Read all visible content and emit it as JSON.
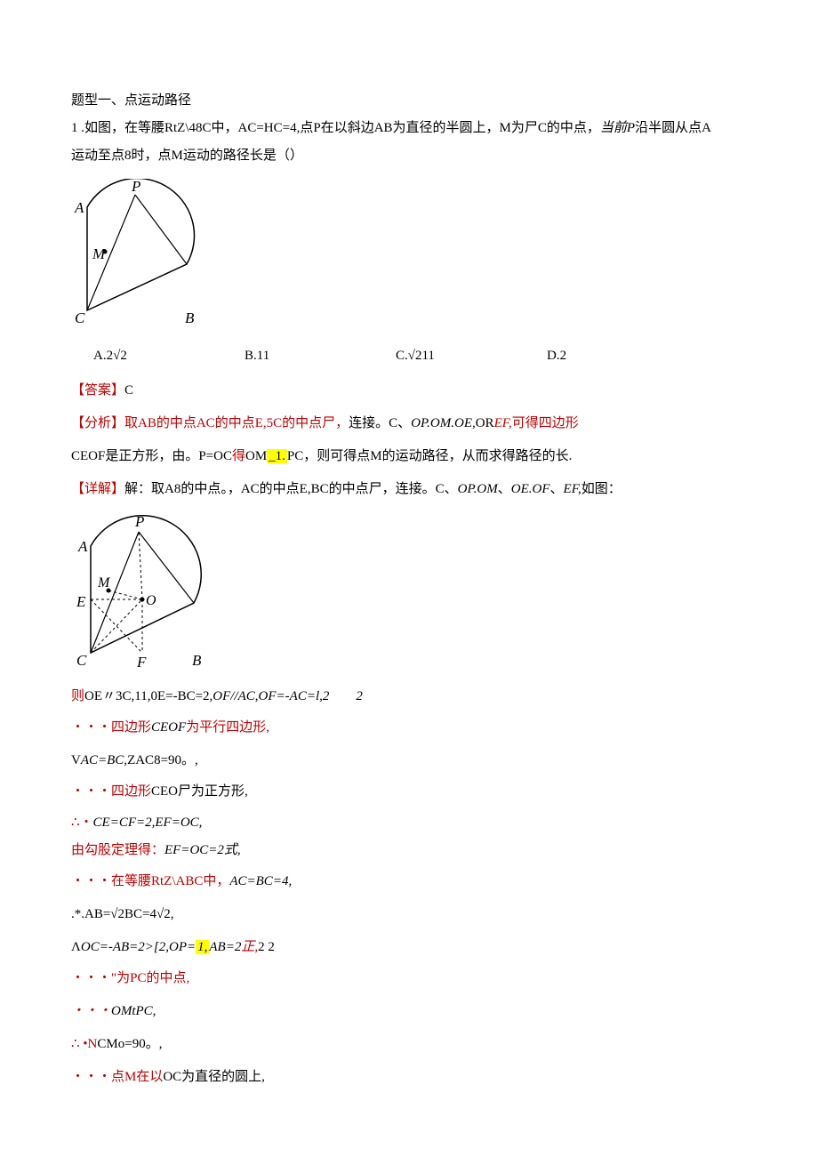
{
  "heading": "题型一、点运动路径",
  "q1_stem_p1": "1 .如图，在等腰RtZ\\48C中，AC=HC=4,点P在以斜边AB为直径的半圆上，M为尸C的中点，",
  "q1_stem_p1_em": "当前P",
  "q1_stem_p1_tail": "沿半圆从点A",
  "q1_stem_p2": "运动至点8时，点M运动的路径长是（）",
  "options": {
    "a": "A.2√2",
    "b": "B.11",
    "c": "C.√211",
    "d": "D.2"
  },
  "ans_label": "【答案】",
  "ans_val": "C",
  "analysis_label": "【分析】",
  "analysis_p1a": "取AB的中点AC的中点E,5C的中点尸，",
  "analysis_p1b": "连接。C、",
  "analysis_p1c": "OP.OM.OE,",
  "analysis_p1d": "OR",
  "analysis_p1e": "EF,",
  "analysis_p1f": "可得四边形",
  "analysis_p2a": "CEOF是正方形，由。P=OC",
  "analysis_p2b": "得",
  "analysis_p2c": "OM",
  "analysis_p2d": "_1.",
  "analysis_p2e": "PC，则可得点M的运动路径，从而求得路径的长.",
  "detail_label": "【详解】",
  "detail_p1a": "解：取A8的中点。，AC的中点E,BC的中点尸，连接。C、",
  "detail_p1b": "OP.OM",
  "detail_p1c": "、",
  "detail_p1d": "OE.OF",
  "detail_p1e": "、",
  "detail_p1f": "EF,",
  "detail_p1g": "如图：",
  "line_oe_a": "则",
  "line_oe_b": "OE〃3C,11,0E=-BC=2,",
  "line_oe_c": "OF//AC,OF=-AC=l,2",
  "line_oe_d": "        ",
  "line_oe_e": "2",
  "line_ceof1_a": "・・・四边形",
  "line_ceof1_b": "CEOF",
  "line_ceof1_c": "为平行四边形,",
  "line_acbc_a": "V",
  "line_acbc_b": "AC=BC,",
  "line_acbc_c": "ZAC8=90。,",
  "line_ceof2_a": "・・・四边形",
  "line_ceof2_b": "CEO尸为正方形,",
  "line_cecf_a": "∴・",
  "line_cecf_b": "CE=CF=2,EF=OC,",
  "line_gougu_a": "由勾股定理得：",
  "line_gougu_b": "EF=OC=2式,",
  "line_rtabc_a": "・・・在等腰RtZ\\ABC中，",
  "line_rtabc_b": "AC=BC=4,",
  "line_ab": ".*.AB=√2BC=4√2,",
  "line_oc_a": "Λ",
  "line_oc_b": "OC=-AB=2>[2,OP=",
  "line_oc_hl": "1,",
  "line_oc_c": "AB=2",
  "line_oc_d": "正,",
  "line_oc_e": "2  2",
  "line_pc_a": "・・・\"为PC的中点,",
  "line_omtpc_a": "・・・",
  "line_omtpc_b": "OMtPC,",
  "line_ncmo_a": "∴ •N",
  "line_ncmo_b": "CMo=90。,",
  "line_last_a": "・・・点M在以",
  "line_last_b": "OC为直径的圆上,"
}
